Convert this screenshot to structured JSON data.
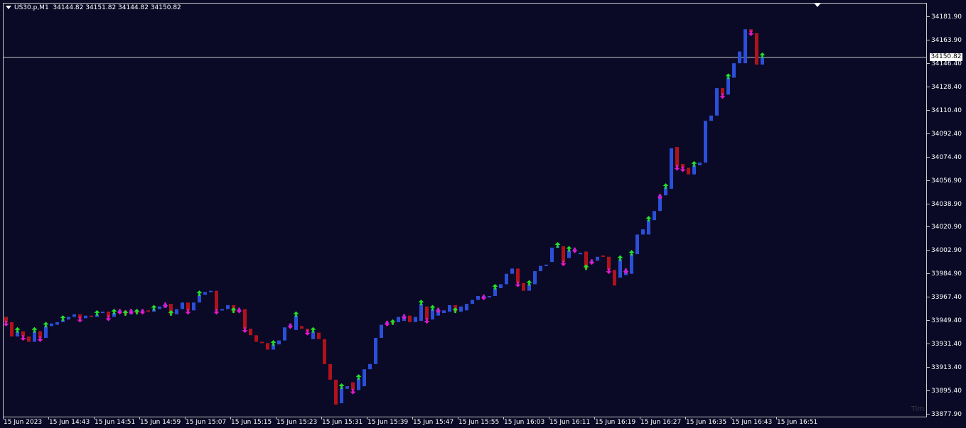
{
  "header": {
    "symbol": "US30.p,M1",
    "ohlc": "34144.82 34151.82 34144.82 34150.82"
  },
  "colors": {
    "background": "#0a0a26",
    "bull": "#2b4fd8",
    "bear": "#b0121c",
    "up_arrow": "#22e02a",
    "down_arrow": "#e418c8",
    "price_line": "#c8c8c8"
  },
  "current_price": {
    "value": 34150.82,
    "label": "34150.82"
  },
  "watermark": "Tim",
  "chart_data": {
    "type": "candlestick",
    "y_axis_ticks": [
      "34181.90",
      "34163.90",
      "34146.40",
      "34128.40",
      "34110.40",
      "34092.40",
      "34074.40",
      "34056.90",
      "34038.90",
      "34020.90",
      "34002.90",
      "33984.90",
      "33967.40",
      "33949.40",
      "33931.40",
      "33913.40",
      "33895.40",
      "33877.90"
    ],
    "x_axis_ticks": [
      "15 Jun 2023",
      "15 Jun 14:43",
      "15 Jun 14:51",
      "15 Jun 14:59",
      "15 Jun 15:07",
      "15 Jun 15:15",
      "15 Jun 15:23",
      "15 Jun 15:31",
      "15 Jun 15:39",
      "15 Jun 15:47",
      "15 Jun 15:55",
      "15 Jun 16:03",
      "15 Jun 16:11",
      "15 Jun 16:19",
      "15 Jun 16:27",
      "15 Jun 16:35",
      "15 Jun 16:43",
      "15 Jun 16:51"
    ],
    "ylim": [
      33877.9,
      34181.9
    ],
    "candles": [
      {
        "o": 33952,
        "c": 33948,
        "a": "d"
      },
      {
        "o": 33948,
        "c": 33937,
        "a": ""
      },
      {
        "o": 33937,
        "c": 33941,
        "a": "u"
      },
      {
        "o": 33941,
        "c": 33937,
        "a": "d"
      },
      {
        "o": 33937,
        "c": 33933,
        "a": ""
      },
      {
        "o": 33933,
        "c": 33941,
        "a": "u"
      },
      {
        "o": 33941,
        "c": 33936,
        "a": "d"
      },
      {
        "o": 33936,
        "c": 33945,
        "a": "u"
      },
      {
        "o": 33945,
        "c": 33947,
        "a": ""
      },
      {
        "o": 33946,
        "c": 33948,
        "a": ""
      },
      {
        "o": 33948,
        "c": 33950,
        "a": "u"
      },
      {
        "o": 33950,
        "c": 33952,
        "a": ""
      },
      {
        "o": 33952,
        "c": 33954,
        "a": ""
      },
      {
        "o": 33954,
        "c": 33951,
        "a": "d"
      },
      {
        "o": 33951,
        "c": 33953,
        "a": ""
      },
      {
        "o": 33953,
        "c": 33952,
        "a": ""
      },
      {
        "o": 33952,
        "c": 33954,
        "a": "u"
      },
      {
        "o": 33955,
        "c": 33956,
        "a": ""
      },
      {
        "o": 33956,
        "c": 33952,
        "a": "d"
      },
      {
        "o": 33952,
        "c": 33955,
        "a": "u"
      },
      {
        "o": 33955,
        "c": 33957,
        "a": "d"
      },
      {
        "o": 33957,
        "c": 33954,
        "a": "u"
      },
      {
        "o": 33954,
        "c": 33957,
        "a": "d"
      },
      {
        "o": 33957,
        "c": 33955,
        "a": "u"
      },
      {
        "o": 33955,
        "c": 33957,
        "a": "d"
      },
      {
        "o": 33957,
        "c": 33956,
        "a": ""
      },
      {
        "o": 33956,
        "c": 33958,
        "a": "u"
      },
      {
        "o": 33958,
        "c": 33960,
        "a": ""
      },
      {
        "o": 33959,
        "c": 33962,
        "a": "d"
      },
      {
        "o": 33962,
        "c": 33954,
        "a": "u"
      },
      {
        "o": 33954,
        "c": 33958,
        "a": ""
      },
      {
        "o": 33958,
        "c": 33963,
        "a": ""
      },
      {
        "o": 33963,
        "c": 33957,
        "a": "d"
      },
      {
        "o": 33957,
        "c": 33963,
        "a": ""
      },
      {
        "o": 33963,
        "c": 33969,
        "a": "u"
      },
      {
        "o": 33969,
        "c": 33971,
        "a": ""
      },
      {
        "o": 33971,
        "c": 33972,
        "a": ""
      },
      {
        "o": 33972,
        "c": 33957,
        "a": "d"
      },
      {
        "o": 33957,
        "c": 33958,
        "a": ""
      },
      {
        "o": 33958,
        "c": 33961,
        "a": ""
      },
      {
        "o": 33961,
        "c": 33956,
        "a": "u"
      },
      {
        "o": 33956,
        "c": 33958,
        "a": "d"
      },
      {
        "o": 33958,
        "c": 33943,
        "a": "d"
      },
      {
        "o": 33943,
        "c": 33938,
        "a": ""
      },
      {
        "o": 33938,
        "c": 33933,
        "a": ""
      },
      {
        "o": 33933,
        "c": 33932,
        "a": ""
      },
      {
        "o": 33932,
        "c": 33927,
        "a": ""
      },
      {
        "o": 33927,
        "c": 33931,
        "a": "u"
      },
      {
        "o": 33931,
        "c": 33934,
        "a": ""
      },
      {
        "o": 33934,
        "c": 33944,
        "a": ""
      },
      {
        "o": 33944,
        "c": 33946,
        "a": "d"
      },
      {
        "o": 33942,
        "c": 33953,
        "a": "u"
      },
      {
        "o": 33945,
        "c": 33943,
        "a": ""
      },
      {
        "o": 33943,
        "c": 33941,
        "a": "d"
      },
      {
        "o": 33935,
        "c": 33941,
        "a": "u"
      },
      {
        "o": 33940,
        "c": 33935,
        "a": ""
      },
      {
        "o": 33935,
        "c": 33916,
        "a": ""
      },
      {
        "o": 33916,
        "c": 33904,
        "a": ""
      },
      {
        "o": 33904,
        "c": 33885,
        "a": ""
      },
      {
        "o": 33886,
        "c": 33898,
        "a": "u"
      },
      {
        "o": 33897,
        "c": 33899,
        "a": ""
      },
      {
        "o": 33902,
        "c": 33896,
        "a": "d"
      },
      {
        "o": 33896,
        "c": 33905,
        "a": "u"
      },
      {
        "o": 33899,
        "c": 33912,
        "a": ""
      },
      {
        "o": 33912,
        "c": 33916,
        "a": ""
      },
      {
        "o": 33916,
        "c": 33936,
        "a": ""
      },
      {
        "o": 33936,
        "c": 33946,
        "a": ""
      },
      {
        "o": 33946,
        "c": 33948,
        "a": "d"
      },
      {
        "o": 33948,
        "c": 33947,
        "a": "u"
      },
      {
        "o": 33948,
        "c": 33952,
        "a": ""
      },
      {
        "o": 33949,
        "c": 33953,
        "a": "d"
      },
      {
        "o": 33953,
        "c": 33948,
        "a": ""
      },
      {
        "o": 33948,
        "c": 33952,
        "a": ""
      },
      {
        "o": 33949,
        "c": 33962,
        "a": "u"
      },
      {
        "o": 33960,
        "c": 33950,
        "a": "d"
      },
      {
        "o": 33950,
        "c": 33958,
        "a": "u"
      },
      {
        "o": 33953,
        "c": 33958,
        "a": "d"
      },
      {
        "o": 33955,
        "c": 33957,
        "a": ""
      },
      {
        "o": 33956,
        "c": 33961,
        "a": ""
      },
      {
        "o": 33961,
        "c": 33956,
        "a": "u"
      },
      {
        "o": 33956,
        "c": 33960,
        "a": ""
      },
      {
        "o": 33957,
        "c": 33962,
        "a": ""
      },
      {
        "o": 33962,
        "c": 33965,
        "a": ""
      },
      {
        "o": 33965,
        "c": 33968,
        "a": ""
      },
      {
        "o": 33968,
        "c": 33968,
        "a": "d"
      },
      {
        "o": 33968,
        "c": 33968,
        "a": ""
      },
      {
        "o": 33968,
        "c": 33974,
        "a": "u"
      },
      {
        "o": 33974,
        "c": 33977,
        "a": ""
      },
      {
        "o": 33977,
        "c": 33985,
        "a": ""
      },
      {
        "o": 33985,
        "c": 33989,
        "a": ""
      },
      {
        "o": 33989,
        "c": 33978,
        "a": "d"
      },
      {
        "o": 33978,
        "c": 33972,
        "a": ""
      },
      {
        "o": 33972,
        "c": 33977,
        "a": "u"
      },
      {
        "o": 33977,
        "c": 33987,
        "a": ""
      },
      {
        "o": 33987,
        "c": 33991,
        "a": ""
      },
      {
        "o": 33991,
        "c": 33992,
        "a": ""
      },
      {
        "o": 33994,
        "c": 34005,
        "a": ""
      },
      {
        "o": 34005,
        "c": 34006,
        "a": "u"
      },
      {
        "o": 34006,
        "c": 33994,
        "a": "d"
      },
      {
        "o": 33997,
        "c": 34003,
        "a": "u"
      },
      {
        "o": 34003,
        "c": 34004,
        "a": "d"
      },
      {
        "o": 34000,
        "c": 34001,
        "a": ""
      },
      {
        "o": 34002,
        "c": 33989,
        "a": "u"
      },
      {
        "o": 33995,
        "c": 33995,
        "a": "d"
      },
      {
        "o": 33995,
        "c": 33998,
        "a": ""
      },
      {
        "o": 33999,
        "c": 33998,
        "a": ""
      },
      {
        "o": 33998,
        "c": 33988,
        "a": "d"
      },
      {
        "o": 33988,
        "c": 33976,
        "a": ""
      },
      {
        "o": 33982,
        "c": 33996,
        "a": "u"
      },
      {
        "o": 33984,
        "c": 33988,
        "a": "d"
      },
      {
        "o": 33985,
        "c": 34000,
        "a": "u"
      },
      {
        "o": 34000,
        "c": 34015,
        "a": ""
      },
      {
        "o": 34015,
        "c": 34019,
        "a": ""
      },
      {
        "o": 34015,
        "c": 34026,
        "a": "u"
      },
      {
        "o": 34026,
        "c": 34033,
        "a": ""
      },
      {
        "o": 34033,
        "c": 34045,
        "a": "d"
      },
      {
        "o": 34045,
        "c": 34051,
        "a": "u"
      },
      {
        "o": 34050,
        "c": 34081,
        "a": ""
      },
      {
        "o": 34082,
        "c": 34067,
        "a": "d"
      },
      {
        "o": 34069,
        "c": 34066,
        "a": "d"
      },
      {
        "o": 34066,
        "c": 34061,
        "a": ""
      },
      {
        "o": 34061,
        "c": 34068,
        "a": "u"
      },
      {
        "o": 34068,
        "c": 34070,
        "a": ""
      },
      {
        "o": 34070,
        "c": 34102,
        "a": ""
      },
      {
        "o": 34102,
        "c": 34106,
        "a": ""
      },
      {
        "o": 34106,
        "c": 34127,
        "a": ""
      },
      {
        "o": 34127,
        "c": 34122,
        "a": "d"
      },
      {
        "o": 34122,
        "c": 34135,
        "a": "u"
      },
      {
        "o": 34135,
        "c": 34146,
        "a": ""
      },
      {
        "o": 34146,
        "c": 34155,
        "a": ""
      },
      {
        "o": 34146,
        "c": 34172,
        "a": ""
      },
      {
        "o": 34172,
        "c": 34170,
        "a": "d"
      },
      {
        "o": 34169,
        "c": 34145,
        "a": ""
      },
      {
        "o": 34145,
        "c": 34151,
        "a": "u"
      }
    ]
  }
}
